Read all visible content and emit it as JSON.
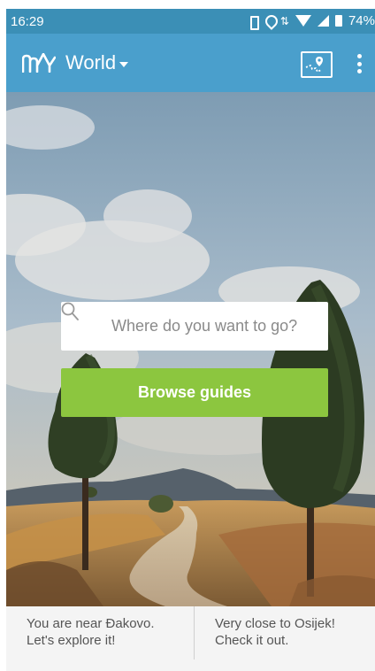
{
  "status_bar": {
    "time": "16:29",
    "battery": "74%",
    "icons": [
      "vibrate-icon",
      "location-icon",
      "data-arrows-icon",
      "wifi-icon",
      "signal-icon",
      "battery-icon"
    ]
  },
  "app_bar": {
    "title": "World",
    "logo_icon": "mountain-logo-icon",
    "map_icon": "map-icon",
    "menu_icon": "more-vert-icon"
  },
  "search": {
    "placeholder": "Where do you want to go?",
    "icon": "search-icon"
  },
  "browse_button": {
    "label": "Browse guides"
  },
  "suggestions": {
    "left": {
      "line1": "You are near Đakovo.",
      "line2": "Let's explore it!"
    },
    "right": {
      "line1": "Very close to Osijek!",
      "line2": "Check it out."
    }
  },
  "colors": {
    "status_bar": "#3b8fb6",
    "app_bar": "#4a9fcc",
    "accent_green": "#8cc63f",
    "suggest_bg": "#f4f4f4"
  }
}
